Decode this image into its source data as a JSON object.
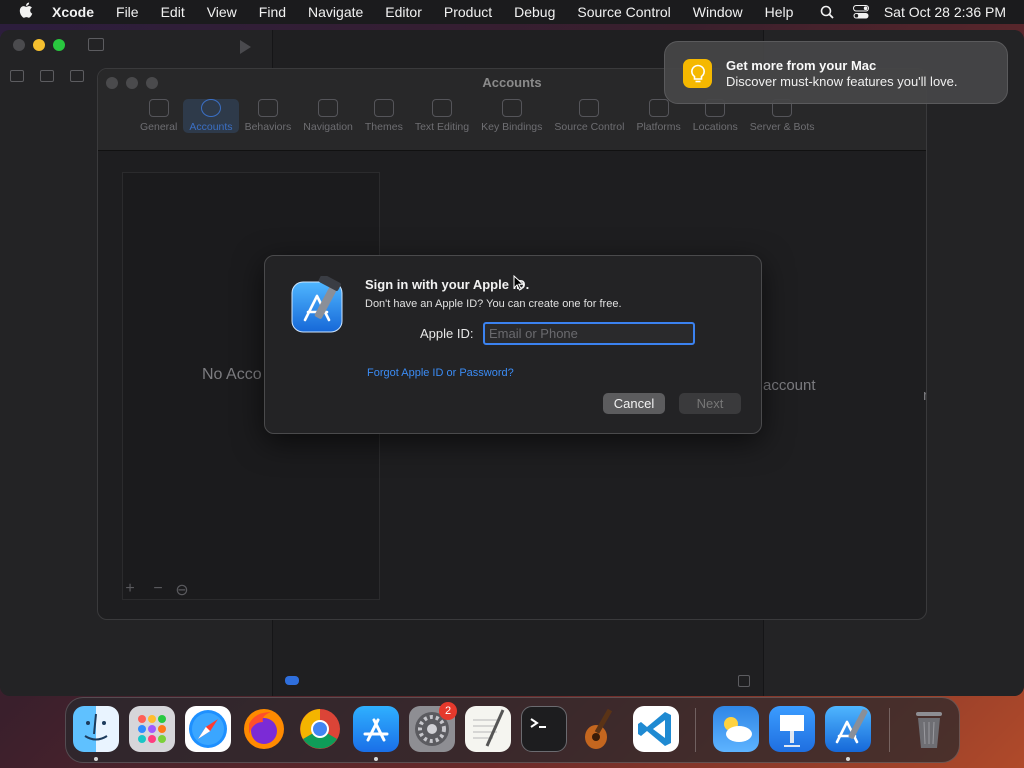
{
  "menubar": {
    "app_name": "Xcode",
    "items": [
      "File",
      "Edit",
      "View",
      "Find",
      "Navigate",
      "Editor",
      "Product",
      "Debug",
      "Source Control",
      "Window",
      "Help"
    ],
    "clock": "Sat Oct 28  2:36 PM"
  },
  "settings": {
    "title": "Accounts",
    "tabs": [
      "General",
      "Accounts",
      "Behaviors",
      "Navigation",
      "Themes",
      "Text Editing",
      "Key Bindings",
      "Source Control",
      "Platforms",
      "Locations",
      "Server & Bots"
    ],
    "selected_tab": "Accounts",
    "no_accounts_text": "No Acco",
    "add_account_text": "account",
    "edge_text": "n",
    "add_button": "+",
    "remove_button": "−",
    "options_button": "⊖"
  },
  "sheet": {
    "title": "Sign in with your Apple ID.",
    "subtitle": "Don't have an Apple ID? You can create one for free.",
    "apple_id_label": "Apple ID:",
    "apple_id_value": "",
    "apple_id_placeholder": "Email or Phone",
    "forgot_link": "Forgot Apple ID or Password?",
    "cancel_label": "Cancel",
    "next_label": "Next"
  },
  "notification": {
    "title": "Get more from your Mac",
    "body": "Discover must-know features you'll love.",
    "icon": "lightbulb-icon"
  },
  "dock": {
    "apps": [
      "Finder",
      "Launchpad",
      "Safari",
      "Firefox",
      "Chrome",
      "App Store",
      "System Settings",
      "TextEdit",
      "Terminal",
      "GarageBand",
      "Visual Studio Code",
      "Weather",
      "Keynote",
      "Xcode",
      "Trash"
    ],
    "system_settings_badge": "2"
  },
  "colors": {
    "accent": "#3b82f0",
    "link": "#3b8cf5",
    "badge": "#e5392c",
    "notification_icon": "#f5b800"
  }
}
